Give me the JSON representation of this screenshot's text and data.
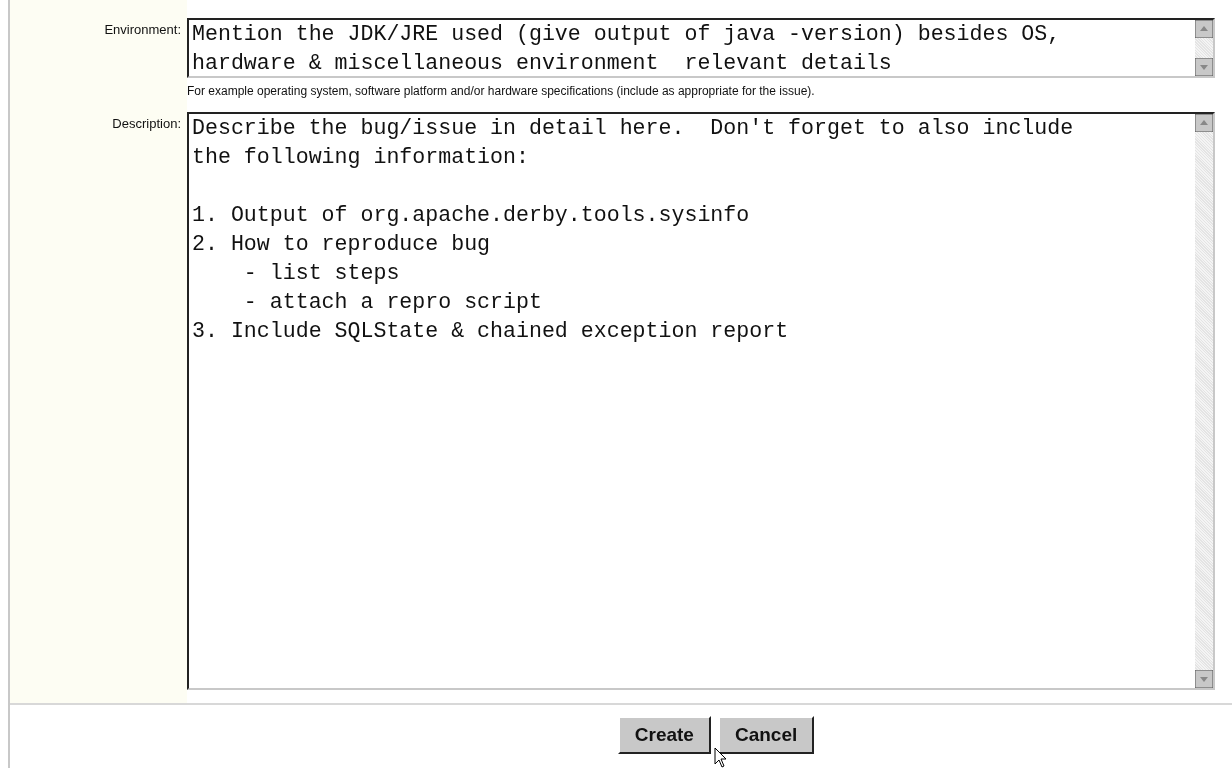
{
  "fields": [
    {
      "label": "Environment:",
      "value": "Mention the JDK/JRE used (give output of java -version) besides OS,\nhardware & miscellaneous environment  relevant details",
      "hint": "For example operating system, software platform and/or hardware specifications (include as appropriate for the issue).",
      "kind": "short"
    },
    {
      "label": "Description:",
      "value": "Describe the bug/issue in detail here.  Don't forget to also include\nthe following information:\n\n1. Output of org.apache.derby.tools.sysinfo\n2. How to reproduce bug\n    - list steps\n    - attach a repro script\n3. Include SQLState & chained exception report",
      "kind": "tall"
    }
  ],
  "buttons": [
    "Create",
    "Cancel"
  ]
}
